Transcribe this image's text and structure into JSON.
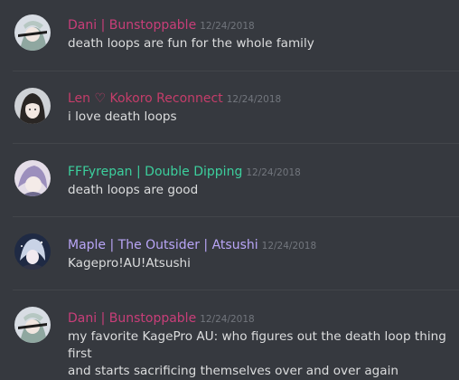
{
  "messages": [
    {
      "username": "Dani | Bunstoppable",
      "username_color": "#c93e79",
      "timestamp": "12/24/2018",
      "lines": [
        "death loops are fun for the whole family"
      ],
      "avatar_icon": "anime-character-avatar-icon"
    },
    {
      "username": "Len ♡ Kokoro Reconnect",
      "username_color": "#c53d6a",
      "timestamp": "12/24/2018",
      "lines": [
        "i love death loops"
      ],
      "avatar_icon": "anime-character-avatar-icon"
    },
    {
      "username": "FFFyrepan | Double Dipping",
      "username_color": "#3ccf9d",
      "timestamp": "12/24/2018",
      "lines": [
        "death loops are good"
      ],
      "avatar_icon": "anime-character-avatar-icon"
    },
    {
      "username": "Maple | The Outsider | Atsushi",
      "username_color": "#b9a5f7",
      "timestamp": "12/24/2018",
      "lines": [
        "Kagepro!AU!Atsushi"
      ],
      "avatar_icon": "anime-character-avatar-icon"
    },
    {
      "username": "Dani | Bunstoppable",
      "username_color": "#c93e79",
      "timestamp": "12/24/2018",
      "lines": [
        "my favorite KagePro AU: who figures out the death loop thing first",
        "and starts sacrificing themselves over and over again"
      ],
      "avatar_icon": "anime-character-avatar-icon"
    }
  ]
}
